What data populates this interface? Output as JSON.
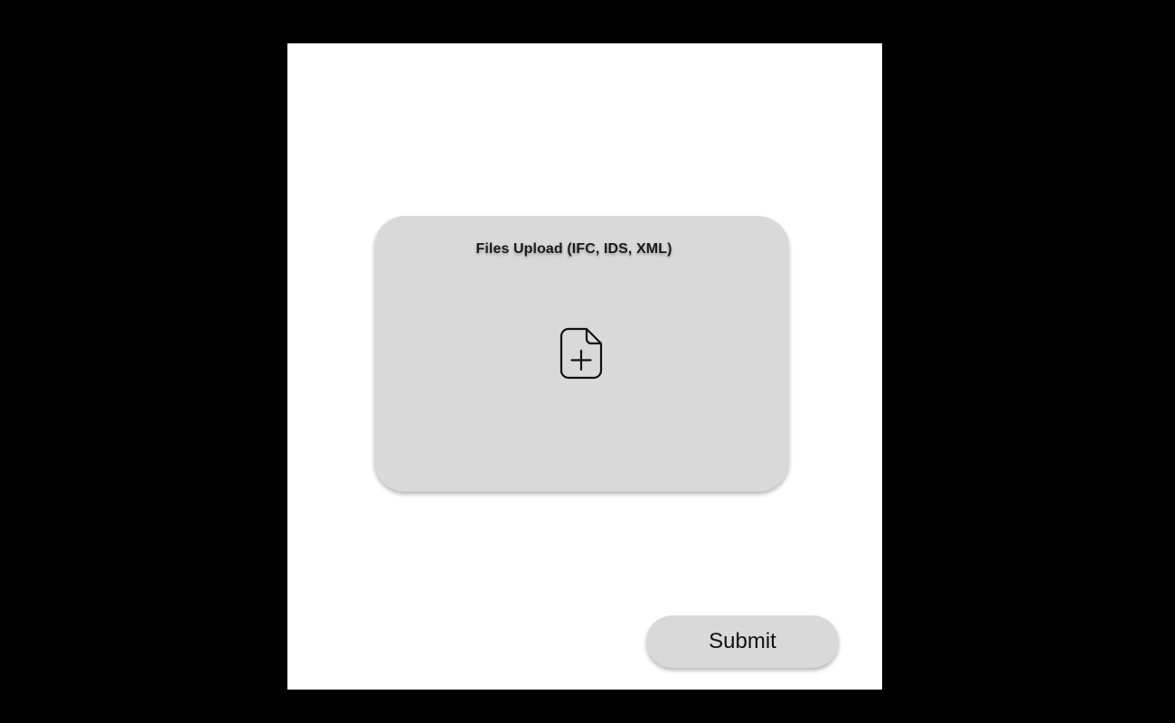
{
  "upload": {
    "title": "Files Upload (IFC, IDS, XML)",
    "icon": "file-plus-icon"
  },
  "actions": {
    "submit_label": "Submit"
  },
  "colors": {
    "background": "#000000",
    "frame": "#ffffff",
    "card": "#d9d9d9",
    "text": "#111111"
  }
}
